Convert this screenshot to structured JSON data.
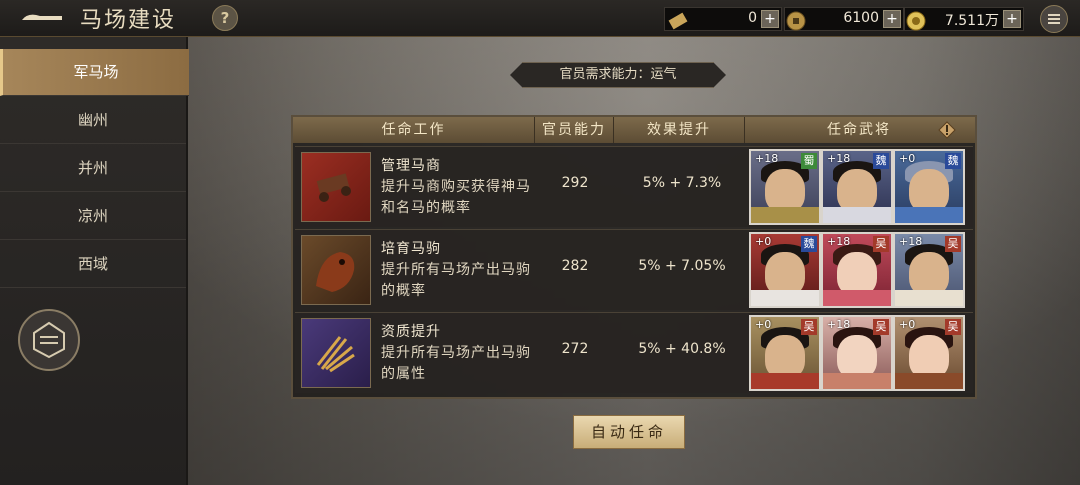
{
  "header": {
    "title": "马场建设",
    "help_label": "?",
    "resources": [
      {
        "icon": "scroll-icon",
        "value": "0",
        "plus": "+"
      },
      {
        "icon": "copper-coin-icon",
        "value": "6100",
        "plus": "+"
      },
      {
        "icon": "gold-coin-icon",
        "value": "7.511万",
        "plus": "+"
      }
    ]
  },
  "sidebar": {
    "items": [
      {
        "label": "军马场",
        "active": true
      },
      {
        "label": "幽州",
        "active": false
      },
      {
        "label": "并州",
        "active": false
      },
      {
        "label": "凉州",
        "active": false
      },
      {
        "label": "西域",
        "active": false
      }
    ]
  },
  "banner": {
    "text": "官员需求能力：运气"
  },
  "table": {
    "headers": [
      "任命工作",
      "官员能力",
      "效果提升",
      "任命武将"
    ],
    "rows": [
      {
        "name": "管理马商",
        "desc": "提升马商购买获得神马和名马的概率",
        "ability": "292",
        "effect": "5% + 7.3%",
        "generals": [
          {
            "bonus": "+18",
            "faction": "蜀",
            "faction_color": "#3d8a3a"
          },
          {
            "bonus": "+18",
            "faction": "魏",
            "faction_color": "#2a4a9a"
          },
          {
            "bonus": "+0",
            "faction": "魏",
            "faction_color": "#2a4a9a"
          }
        ]
      },
      {
        "name": "培育马驹",
        "desc": "提升所有马场产出马驹的概率",
        "ability": "282",
        "effect": "5% + 7.05%",
        "generals": [
          {
            "bonus": "+0",
            "faction": "魏",
            "faction_color": "#2a4a9a"
          },
          {
            "bonus": "+18",
            "faction": "吴",
            "faction_color": "#a33a2a"
          },
          {
            "bonus": "+18",
            "faction": "吴",
            "faction_color": "#a33a2a"
          }
        ]
      },
      {
        "name": "资质提升",
        "desc": "提升所有马场产出马驹的属性",
        "ability": "272",
        "effect": "5% + 40.8%",
        "generals": [
          {
            "bonus": "+0",
            "faction": "吴",
            "faction_color": "#a33a2a"
          },
          {
            "bonus": "+18",
            "faction": "吴",
            "faction_color": "#a33a2a"
          },
          {
            "bonus": "+0",
            "faction": "吴",
            "faction_color": "#a33a2a"
          }
        ]
      }
    ]
  },
  "auto_button": {
    "label": "自动任命"
  }
}
